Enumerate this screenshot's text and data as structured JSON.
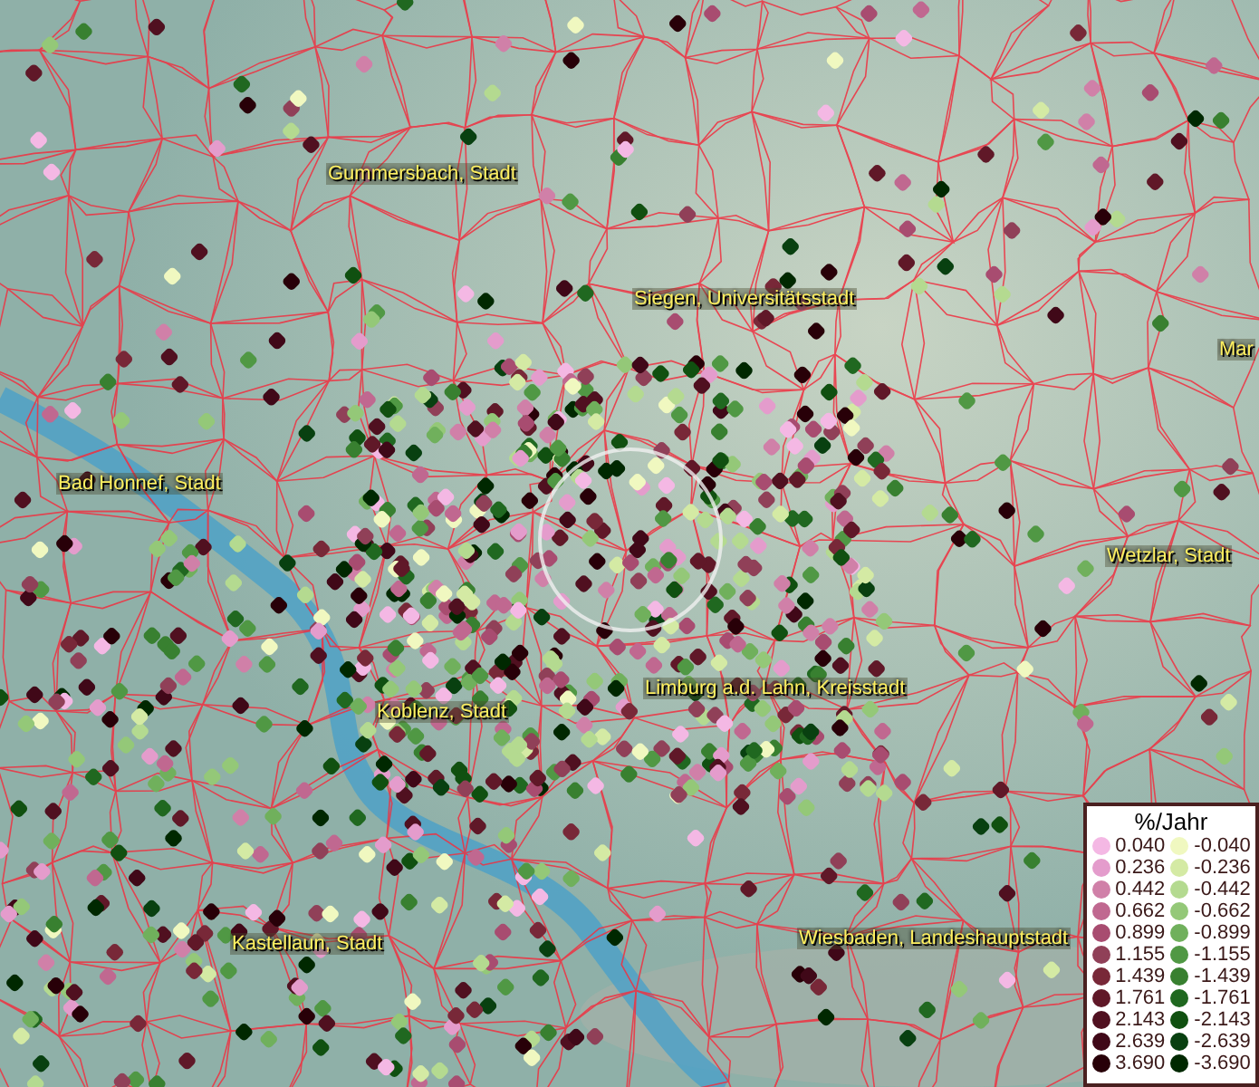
{
  "map_labels": [
    {
      "text": "Gummersbach, Stadt"
    },
    {
      "text": "Siegen, Universitätsstadt"
    },
    {
      "text": "Mar"
    },
    {
      "text": "Bad Honnef, Stadt"
    },
    {
      "text": "Wetzlar, Stadt"
    },
    {
      "text": "Limburg a.d. Lahn, Kreisstadt"
    },
    {
      "text": "Koblenz, Stadt"
    },
    {
      "text": "Kastellaun, Stadt"
    },
    {
      "text": "Wiesbaden, Landeshauptstadt"
    }
  ],
  "legend": {
    "title": "%/Jahr",
    "items": [
      {
        "label": "0.040",
        "color": "#f4b8e4"
      },
      {
        "label": "-0.040",
        "color": "#f0f8c0"
      },
      {
        "label": "0.236",
        "color": "#e49ccc"
      },
      {
        "label": "-0.236",
        "color": "#d4eaa4"
      },
      {
        "label": "0.442",
        "color": "#d080a8"
      },
      {
        "label": "-0.442",
        "color": "#b4da90"
      },
      {
        "label": "0.662",
        "color": "#c06890"
      },
      {
        "label": "-0.662",
        "color": "#94c878"
      },
      {
        "label": "0.899",
        "color": "#a84c70"
      },
      {
        "label": "-0.899",
        "color": "#70b05c"
      },
      {
        "label": "1.155",
        "color": "#904058"
      },
      {
        "label": "-1.155",
        "color": "#509844"
      },
      {
        "label": "1.439",
        "color": "#782838"
      },
      {
        "label": "-1.439",
        "color": "#388030"
      },
      {
        "label": "1.761",
        "color": "#601828"
      },
      {
        "label": "-1.761",
        "color": "#206820"
      },
      {
        "label": "2.143",
        "color": "#501020"
      },
      {
        "label": "-2.143",
        "color": "#105010"
      },
      {
        "label": "2.639",
        "color": "#400818"
      },
      {
        "label": "-2.639",
        "color": "#084010"
      },
      {
        "label": "3.690",
        "color": "#280008"
      },
      {
        "label": "-3.690",
        "color": "#002800"
      }
    ]
  }
}
